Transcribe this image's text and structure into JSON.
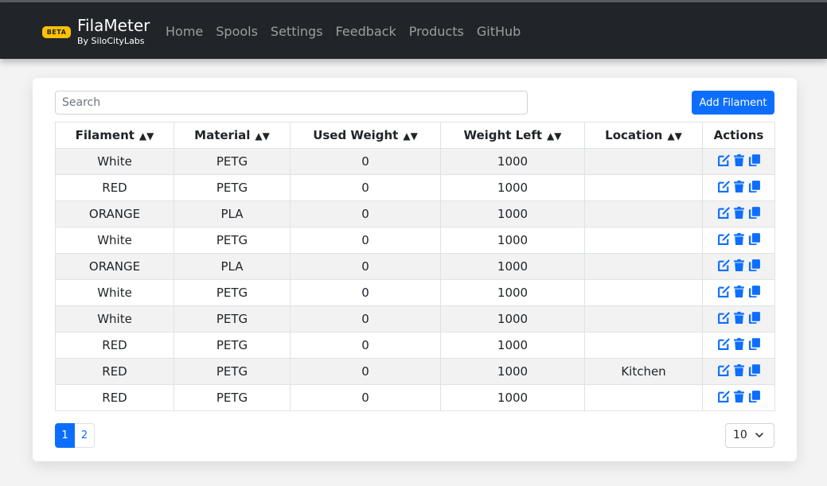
{
  "app": {
    "badge": "BETA",
    "title": "FilaMeter",
    "subtitle": "By SiloCityLabs"
  },
  "nav": [
    {
      "label": "Home"
    },
    {
      "label": "Spools"
    },
    {
      "label": "Settings"
    },
    {
      "label": "Feedback"
    },
    {
      "label": "Products"
    },
    {
      "label": "GitHub"
    }
  ],
  "search": {
    "placeholder": "Search",
    "value": ""
  },
  "add_button": "Add Filament",
  "table": {
    "sort_glyph": "▲▼",
    "columns": [
      {
        "label": "Filament",
        "sortable": true
      },
      {
        "label": "Material",
        "sortable": true
      },
      {
        "label": "Used Weight",
        "sortable": true
      },
      {
        "label": "Weight Left",
        "sortable": true
      },
      {
        "label": "Location",
        "sortable": true
      },
      {
        "label": "Actions",
        "sortable": false
      }
    ],
    "rows": [
      {
        "filament": "White",
        "material": "PETG",
        "used": "0",
        "left": "1000",
        "location": ""
      },
      {
        "filament": "RED",
        "material": "PETG",
        "used": "0",
        "left": "1000",
        "location": ""
      },
      {
        "filament": "ORANGE",
        "material": "PLA",
        "used": "0",
        "left": "1000",
        "location": ""
      },
      {
        "filament": "White",
        "material": "PETG",
        "used": "0",
        "left": "1000",
        "location": ""
      },
      {
        "filament": "ORANGE",
        "material": "PLA",
        "used": "0",
        "left": "1000",
        "location": ""
      },
      {
        "filament": "White",
        "material": "PETG",
        "used": "0",
        "left": "1000",
        "location": ""
      },
      {
        "filament": "White",
        "material": "PETG",
        "used": "0",
        "left": "1000",
        "location": ""
      },
      {
        "filament": "RED",
        "material": "PETG",
        "used": "0",
        "left": "1000",
        "location": ""
      },
      {
        "filament": "RED",
        "material": "PETG",
        "used": "0",
        "left": "1000",
        "location": "Kitchen"
      },
      {
        "filament": "RED",
        "material": "PETG",
        "used": "0",
        "left": "1000",
        "location": ""
      }
    ],
    "action_icons": [
      "edit-icon",
      "trash-icon",
      "copy-icon"
    ]
  },
  "pagination": {
    "pages": [
      "1",
      "2"
    ],
    "current": "1"
  },
  "per_page": {
    "selected": "10"
  },
  "colors": {
    "navbar": "#212529",
    "accent": "#0d6efd",
    "badge": "#ffc107"
  }
}
